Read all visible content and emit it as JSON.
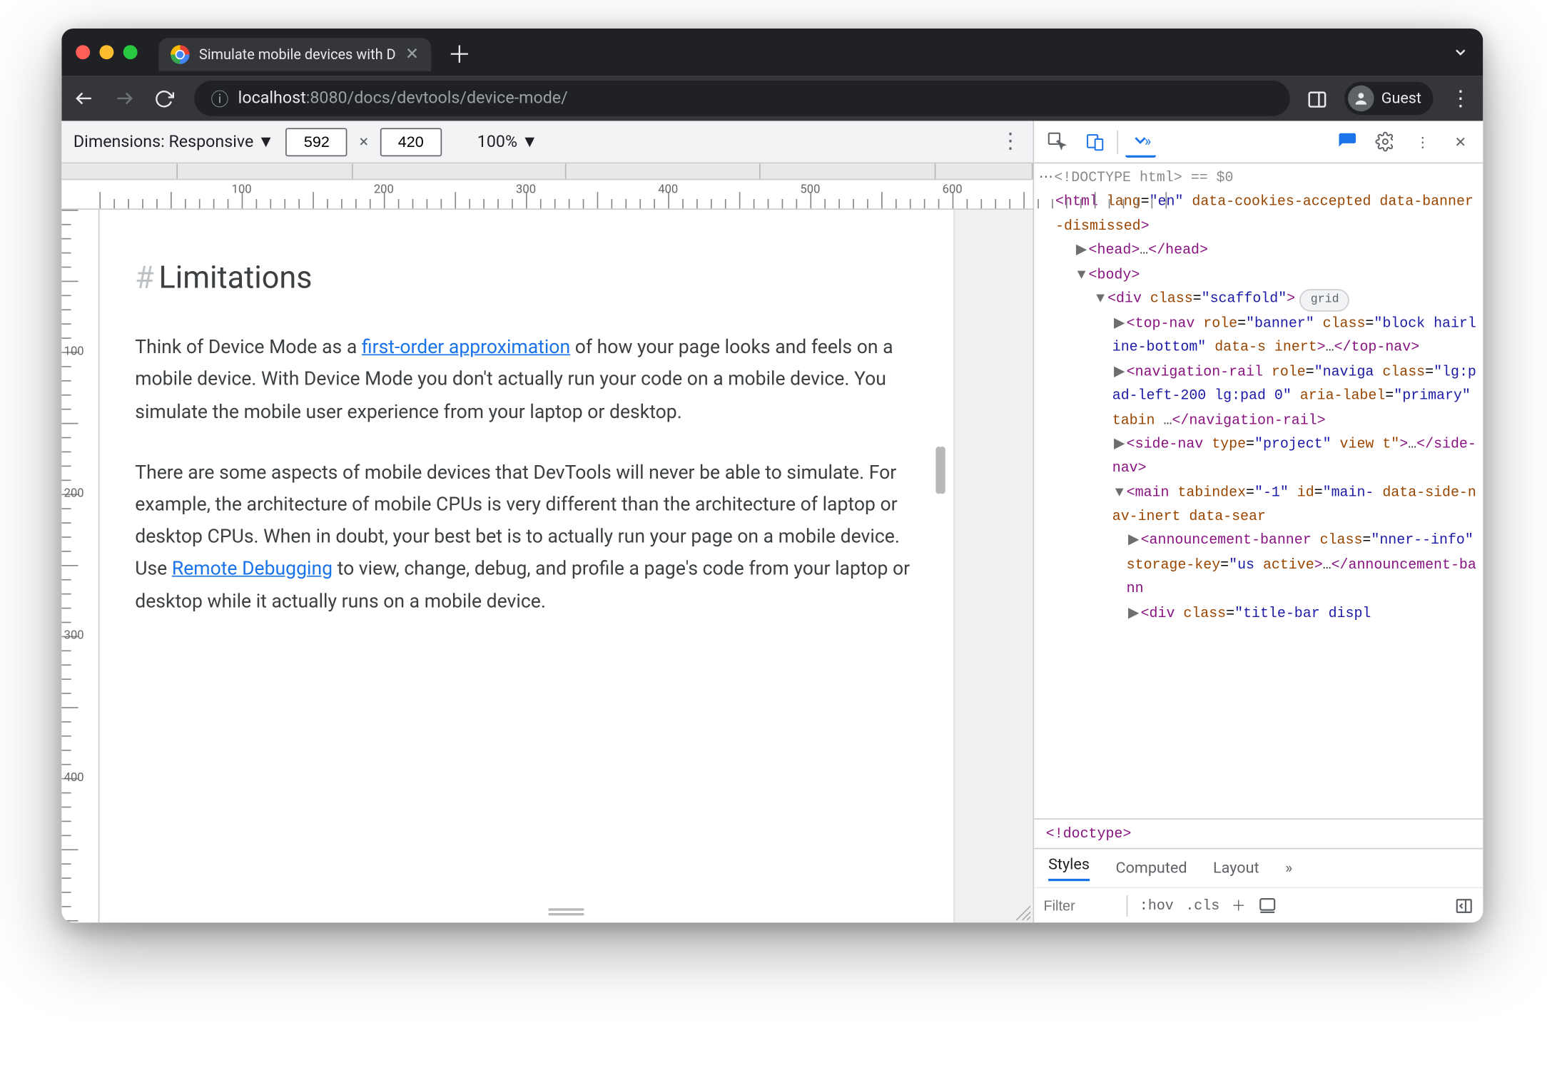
{
  "tab": {
    "title": "Simulate mobile devices with D"
  },
  "url": {
    "host": "localhost",
    "port": ":8080",
    "path": "/docs/devtools/device-mode/"
  },
  "guest_label": "Guest",
  "device_toolbar": {
    "label": "Dimensions: Responsive ▼",
    "width": "592",
    "height": "420",
    "separator": "×",
    "zoom": "100% ▼"
  },
  "ruler_h": [
    "100",
    "200",
    "300",
    "400",
    "500",
    "600"
  ],
  "ruler_v": [
    "100",
    "200",
    "300",
    "400"
  ],
  "content": {
    "heading_hash": "#",
    "heading": "Limitations",
    "p1_a": "Think of Device Mode as a ",
    "p1_link": "first-order approximation",
    "p1_b": " of how your page looks and feels on a mobile device. With Device Mode you don't actually run your code on a mobile device. You simulate the mobile user experience from your laptop or desktop.",
    "p2_a": "There are some aspects of mobile devices that DevTools will never be able to simulate. For example, the architecture of mobile CPUs is very different than the architecture of laptop or desktop CPUs. When in doubt, your best bet is to actually run your page on a mobile device. Use ",
    "p2_link": "Remote Debugging",
    "p2_b": " to view, change, debug, and profile a page's code from your laptop or desktop while it actually runs on a mobile device."
  },
  "dom": {
    "doctype": "<!DOCTYPE html>",
    "eqs": "== $0",
    "html_open": "<html lang=\"en\" data-cookies-accepted data-banner-dismissed>",
    "head": "<head>…</head>",
    "body_open": "<body>",
    "div_open": "<div class=\"scaffold\">",
    "grid": "grid",
    "topnav": "<top-nav role=\"banner\" class=\"block hairline-bottom\" data-s inert>…</top-nav>",
    "navrail": "<navigation-rail role=\"naviga class=\"lg:pad-left-200 lg:pad 0\" aria-label=\"primary\" tabin …</navigation-rail>",
    "sidenav": "<side-nav type=\"project\" view t\">…</side-nav>",
    "main": "<main tabindex=\"-1\" id=\"main- data-side-nav-inert data-sear",
    "banner": "<announcement-banner class=\" nner--info\" storage-key=\"us active>…</announcement-bann",
    "titlebar": "<div class=\"title-bar displ"
  },
  "breadcrumb": "<!doctype>",
  "styles": {
    "tab_styles": "Styles",
    "tab_computed": "Computed",
    "tab_layout": "Layout",
    "filter": "Filter",
    "hov": ":hov",
    "cls": ".cls"
  }
}
